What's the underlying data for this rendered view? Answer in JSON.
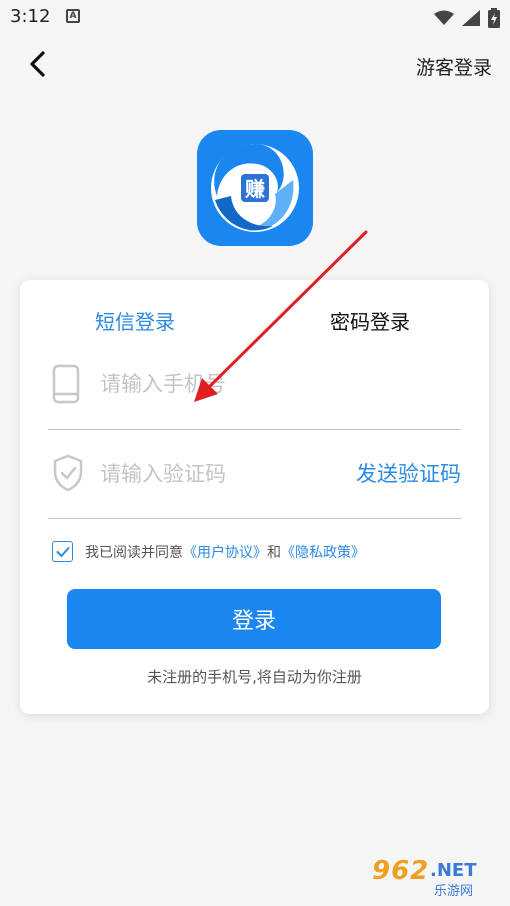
{
  "status_bar": {
    "time": "3:12",
    "icons": [
      "notification-a-icon",
      "wifi-icon",
      "signal-icon",
      "battery-charging-icon"
    ]
  },
  "header": {
    "back_icon": "chevron-left-icon",
    "guest_login": "游客登录"
  },
  "logo": {
    "char": "赚",
    "color": "#1a86f0"
  },
  "tabs": [
    {
      "label": "短信登录",
      "active": true
    },
    {
      "label": "密码登录",
      "active": false
    }
  ],
  "form": {
    "phone_placeholder": "请输入手机号",
    "phone_value": "",
    "code_placeholder": "请输入验证码",
    "code_value": "",
    "send_code": "发送验证码"
  },
  "agreement": {
    "checked": true,
    "prefix": "我已阅读并同意",
    "user_agreement": "《用户协议》",
    "and": "和",
    "privacy_policy": "《隐私政策》"
  },
  "login_button": "登录",
  "register_hint": "未注册的手机号,将自动为你注册",
  "watermark": {
    "main": "962",
    "net": ".NET",
    "sub": "乐游网"
  },
  "colors": {
    "accent": "#1a86f0",
    "link": "#2b8ae2",
    "annotation": "#e02020"
  }
}
